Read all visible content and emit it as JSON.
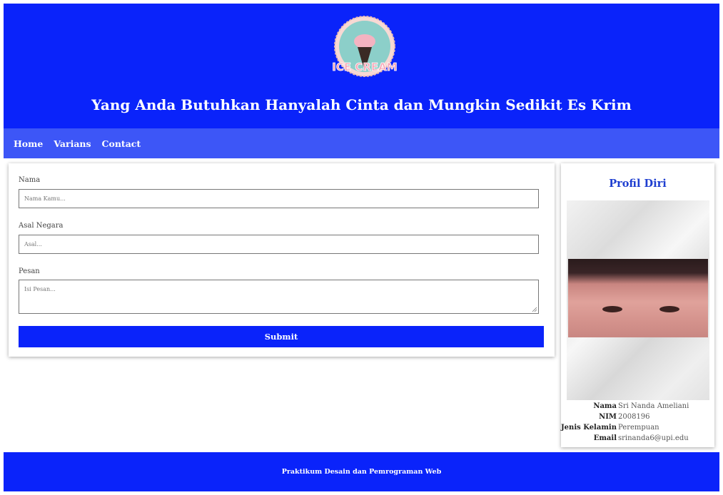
{
  "header": {
    "logo_text": "ICE CREAM",
    "tagline": "Yang Anda Butuhkan Hanyalah Cinta dan Mungkin Sedikit Es Krim"
  },
  "nav": {
    "items": [
      "Home",
      "Varians",
      "Contact"
    ]
  },
  "form": {
    "nama_label": "Nama",
    "nama_placeholder": "Nama Kamu...",
    "negara_label": "Asal Negara",
    "negara_placeholder": "Asal...",
    "pesan_label": "Pesan",
    "pesan_placeholder": "Isi Pesan...",
    "submit_label": "Submit"
  },
  "profile": {
    "title": "Profil Diri",
    "fields": [
      {
        "key": "Nama",
        "value": "Sri Nanda Ameliani"
      },
      {
        "key": "NIM",
        "value": "2008196"
      },
      {
        "key": "Jenis Kelamin",
        "value": "Perempuan"
      },
      {
        "key": "Email",
        "value": "srinanda6@upi.edu"
      }
    ]
  },
  "footer": {
    "text": "Praktikum Desain dan Pemrograman Web"
  },
  "colors": {
    "header_bg": "#0a23fa",
    "nav_bg": "#3d56f7",
    "accent_title": "#1f3fd0"
  }
}
